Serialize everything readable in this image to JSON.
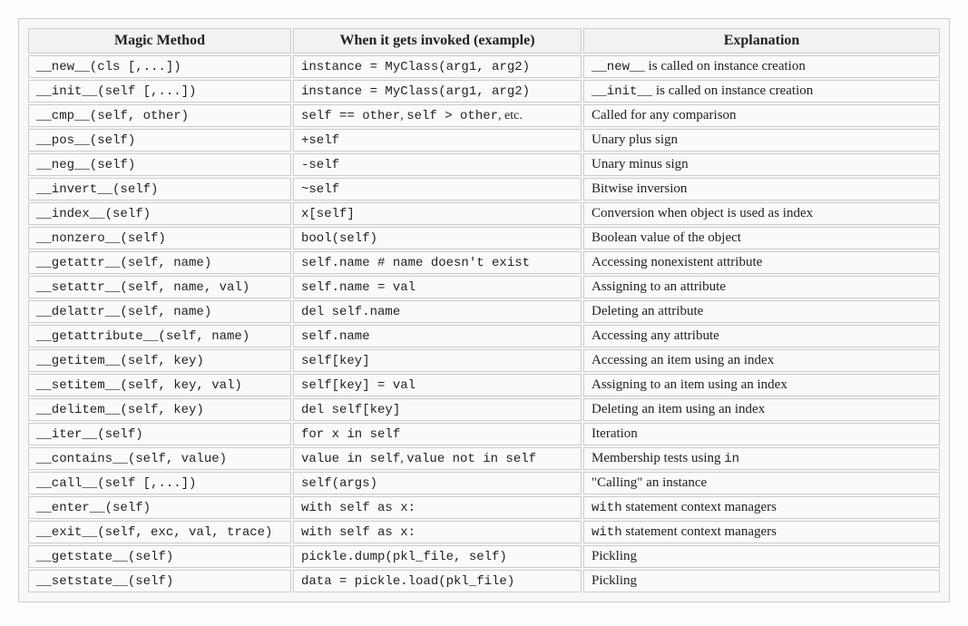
{
  "headers": [
    "Magic Method",
    "When it gets invoked (example)",
    "Explanation"
  ],
  "rows": [
    {
      "method": "__new__(cls [,...])",
      "invoked": [
        {
          "t": "code",
          "v": "instance = MyClass(arg1, arg2)"
        }
      ],
      "explain": [
        {
          "t": "code",
          "v": "__new__"
        },
        {
          "t": "text",
          "v": " is called on instance creation"
        }
      ]
    },
    {
      "method": "__init__(self [,...])",
      "invoked": [
        {
          "t": "code",
          "v": "instance = MyClass(arg1, arg2)"
        }
      ],
      "explain": [
        {
          "t": "code",
          "v": "__init__"
        },
        {
          "t": "text",
          "v": " is called on instance creation"
        }
      ]
    },
    {
      "method": "__cmp__(self, other)",
      "invoked": [
        {
          "t": "code",
          "v": "self == other"
        },
        {
          "t": "serif",
          "v": ", "
        },
        {
          "t": "code",
          "v": "self > other"
        },
        {
          "t": "serif",
          "v": ", etc."
        }
      ],
      "explain": [
        {
          "t": "text",
          "v": "Called for any comparison"
        }
      ]
    },
    {
      "method": "__pos__(self)",
      "invoked": [
        {
          "t": "code",
          "v": "+self"
        }
      ],
      "explain": [
        {
          "t": "text",
          "v": "Unary plus sign"
        }
      ]
    },
    {
      "method": "__neg__(self)",
      "invoked": [
        {
          "t": "code",
          "v": "-self"
        }
      ],
      "explain": [
        {
          "t": "text",
          "v": "Unary minus sign"
        }
      ]
    },
    {
      "method": "__invert__(self)",
      "invoked": [
        {
          "t": "code",
          "v": "~self"
        }
      ],
      "explain": [
        {
          "t": "text",
          "v": "Bitwise inversion"
        }
      ]
    },
    {
      "method": "__index__(self)",
      "invoked": [
        {
          "t": "code",
          "v": "x[self]"
        }
      ],
      "explain": [
        {
          "t": "text",
          "v": "Conversion when object is used as index"
        }
      ]
    },
    {
      "method": "__nonzero__(self)",
      "invoked": [
        {
          "t": "code",
          "v": "bool(self)"
        }
      ],
      "explain": [
        {
          "t": "text",
          "v": "Boolean value of the object"
        }
      ]
    },
    {
      "method": "__getattr__(self, name)",
      "invoked": [
        {
          "t": "code",
          "v": "self.name # name doesn't exist"
        }
      ],
      "explain": [
        {
          "t": "text",
          "v": "Accessing nonexistent attribute"
        }
      ]
    },
    {
      "method": "__setattr__(self, name, val)",
      "invoked": [
        {
          "t": "code",
          "v": "self.name = val"
        }
      ],
      "explain": [
        {
          "t": "text",
          "v": "Assigning to an attribute"
        }
      ]
    },
    {
      "method": "__delattr__(self, name)",
      "invoked": [
        {
          "t": "code",
          "v": "del self.name"
        }
      ],
      "explain": [
        {
          "t": "text",
          "v": "Deleting an attribute"
        }
      ]
    },
    {
      "method": "__getattribute__(self, name)",
      "invoked": [
        {
          "t": "code",
          "v": "self.name"
        }
      ],
      "explain": [
        {
          "t": "text",
          "v": "Accessing any attribute"
        }
      ]
    },
    {
      "method": "__getitem__(self, key)",
      "invoked": [
        {
          "t": "code",
          "v": "self[key]"
        }
      ],
      "explain": [
        {
          "t": "text",
          "v": "Accessing an item using an index"
        }
      ]
    },
    {
      "method": "__setitem__(self, key, val)",
      "invoked": [
        {
          "t": "code",
          "v": "self[key] = val"
        }
      ],
      "explain": [
        {
          "t": "text",
          "v": "Assigning to an item using an index"
        }
      ]
    },
    {
      "method": "__delitem__(self, key)",
      "invoked": [
        {
          "t": "code",
          "v": "del self[key]"
        }
      ],
      "explain": [
        {
          "t": "text",
          "v": "Deleting an item using an index"
        }
      ]
    },
    {
      "method": "__iter__(self)",
      "invoked": [
        {
          "t": "code",
          "v": "for x in self"
        }
      ],
      "explain": [
        {
          "t": "text",
          "v": "Iteration"
        }
      ]
    },
    {
      "method": "__contains__(self, value)",
      "invoked": [
        {
          "t": "code",
          "v": "value in self"
        },
        {
          "t": "serif",
          "v": ", "
        },
        {
          "t": "code",
          "v": "value not in self"
        }
      ],
      "explain": [
        {
          "t": "text",
          "v": "Membership tests using "
        },
        {
          "t": "code",
          "v": "in"
        }
      ]
    },
    {
      "method": "__call__(self [,...])",
      "invoked": [
        {
          "t": "code",
          "v": "self(args)"
        }
      ],
      "explain": [
        {
          "t": "text",
          "v": "\"Calling\" an instance"
        }
      ]
    },
    {
      "method": "__enter__(self)",
      "invoked": [
        {
          "t": "code",
          "v": "with self as x:"
        }
      ],
      "explain": [
        {
          "t": "code",
          "v": "with"
        },
        {
          "t": "text",
          "v": " statement context managers"
        }
      ]
    },
    {
      "method": "__exit__(self, exc, val, trace)",
      "invoked": [
        {
          "t": "code",
          "v": "with self as x:"
        }
      ],
      "explain": [
        {
          "t": "code",
          "v": "with"
        },
        {
          "t": "text",
          "v": " statement context managers"
        }
      ]
    },
    {
      "method": "__getstate__(self)",
      "invoked": [
        {
          "t": "code",
          "v": "pickle.dump(pkl_file, self)"
        }
      ],
      "explain": [
        {
          "t": "text",
          "v": "Pickling"
        }
      ]
    },
    {
      "method": "__setstate__(self)",
      "invoked": [
        {
          "t": "code",
          "v": "data = pickle.load(pkl_file)"
        }
      ],
      "explain": [
        {
          "t": "text",
          "v": "Pickling"
        }
      ]
    }
  ]
}
